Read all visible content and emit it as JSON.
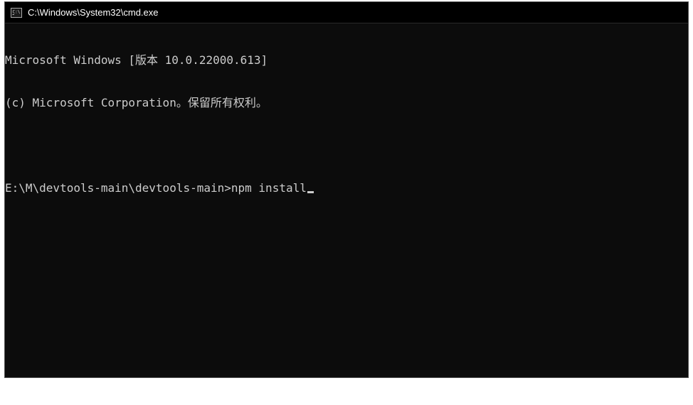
{
  "window": {
    "title": "C:\\Windows\\System32\\cmd.exe"
  },
  "terminal": {
    "line1": "Microsoft Windows [版本 10.0.22000.613]",
    "line2": "(c) Microsoft Corporation。保留所有权利。",
    "blank": "",
    "prompt": "E:\\M\\devtools-main\\devtools-main>",
    "command": "npm install"
  }
}
